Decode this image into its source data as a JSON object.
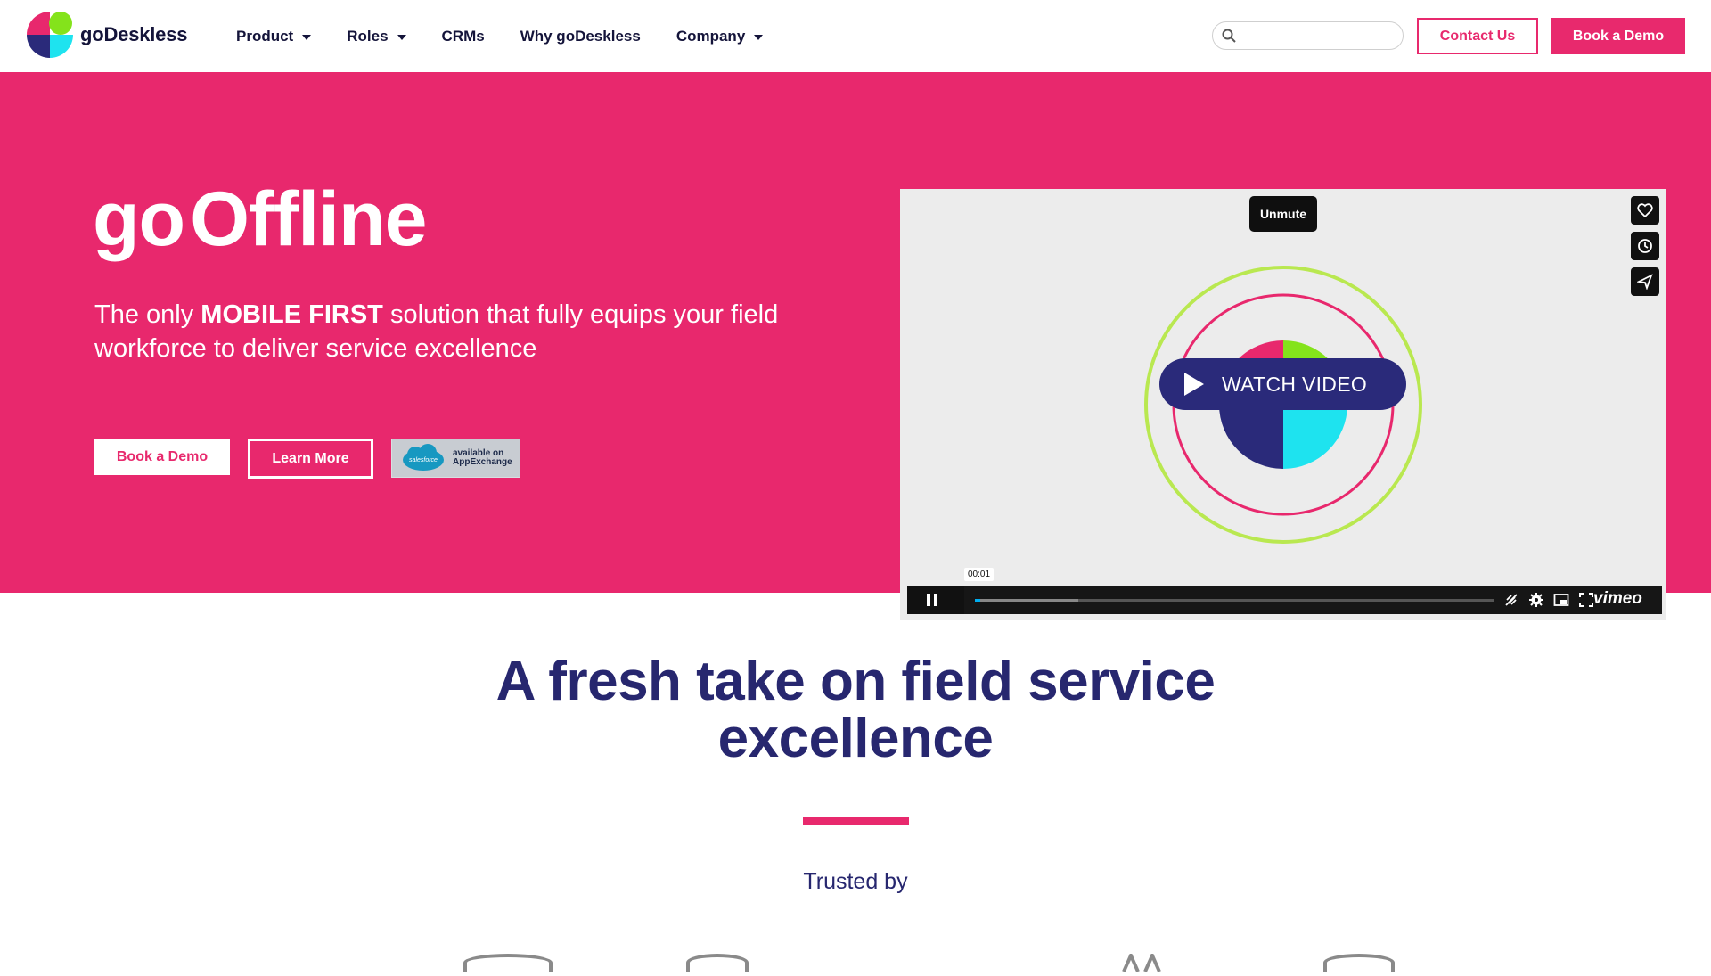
{
  "header": {
    "brand": "goDeskless",
    "nav": [
      {
        "label": "Product",
        "has_dropdown": true
      },
      {
        "label": "Roles",
        "has_dropdown": true
      },
      {
        "label": "CRMs",
        "has_dropdown": false
      },
      {
        "label": "Why goDeskless",
        "has_dropdown": false
      },
      {
        "label": "Company",
        "has_dropdown": true
      }
    ],
    "search": {
      "placeholder": "",
      "value": "",
      "icon": "search-icon"
    },
    "contact_label": "Contact Us",
    "demo_label": "Book a Demo"
  },
  "hero": {
    "title_part1": "go",
    "title_part2": "Offline",
    "subtitle_pre": "The only ",
    "subtitle_bold": "MOBILE FIRST",
    "subtitle_post": " solution that fully equips your field workforce to deliver service excellence",
    "demo_label": "Book a Demo",
    "learn_label": "Learn More",
    "appexchange": {
      "brand": "salesforce",
      "line1": "available on",
      "line2": "AppExchange"
    }
  },
  "video": {
    "unmute_label": "Unmute",
    "watch_label": "WATCH VIDEO",
    "time": "00:01",
    "progress": 0.01,
    "buffered": 0.2,
    "provider": "vimeo",
    "side_icons": [
      "heart-icon",
      "clock-icon",
      "send-icon"
    ],
    "control_icons": [
      "pause-icon",
      "captions-off-icon",
      "settings-icon",
      "pip-icon",
      "fullscreen-icon"
    ]
  },
  "section2": {
    "title_line1": "A fresh take on field service",
    "title_line2": "excellence",
    "trusted_label": "Trusted by"
  },
  "colors": {
    "brand_pink": "#e8286d",
    "brand_navy": "#27276f",
    "accent_green": "#a6e83a",
    "accent_cyan": "#1ee3ef"
  }
}
